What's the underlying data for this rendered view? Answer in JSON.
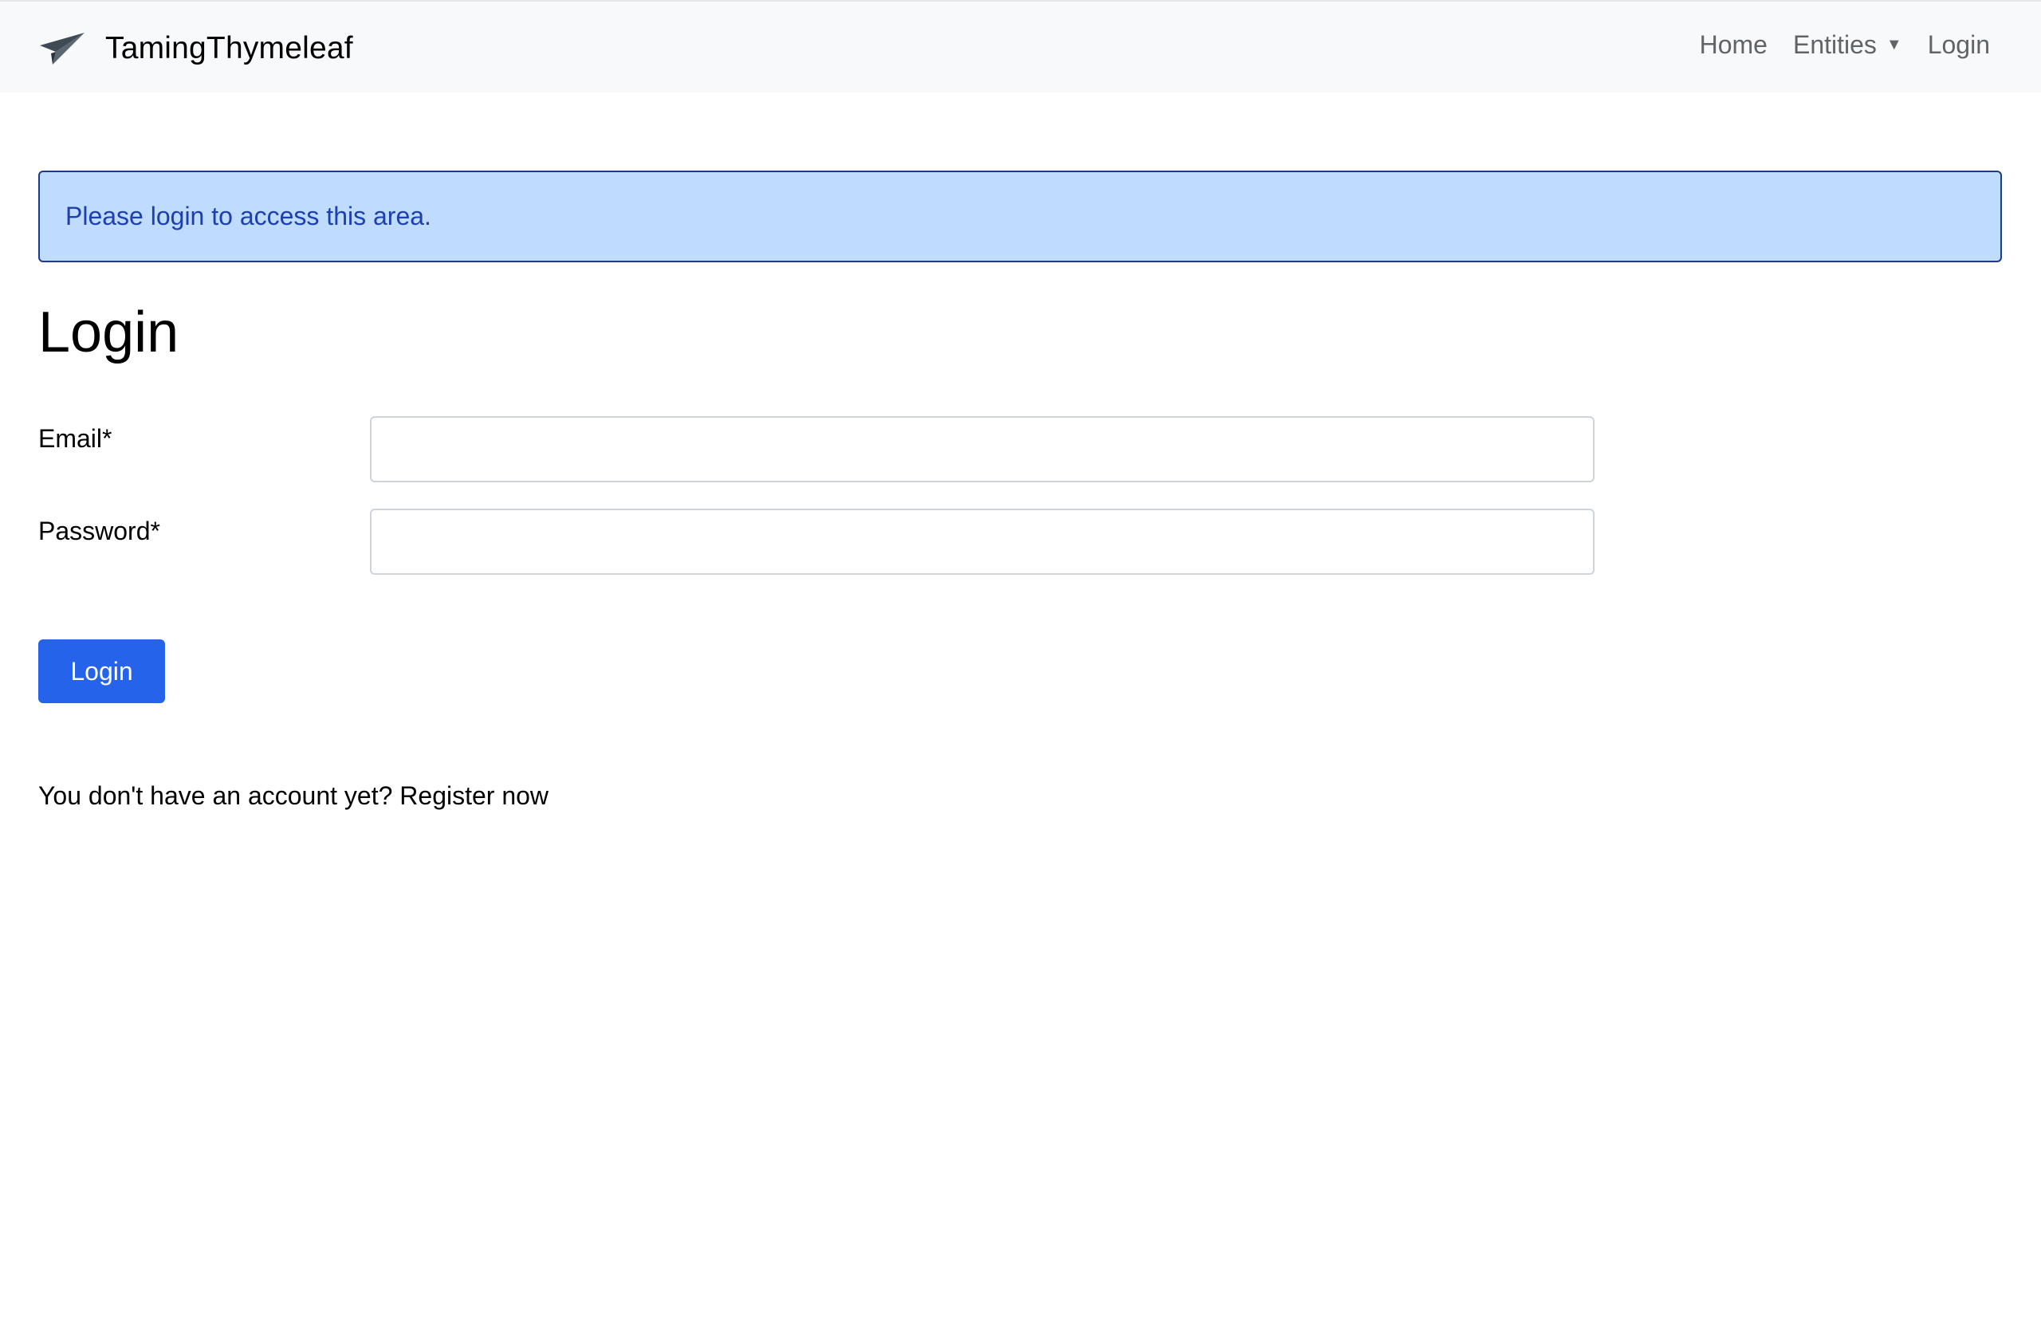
{
  "navbar": {
    "brand_icon": "paper-plane-icon",
    "brand": "TamingThymeleaf",
    "links": {
      "home": "Home",
      "entities": "Entities",
      "entities_caret": "▼",
      "login": "Login"
    }
  },
  "alert": {
    "message": "Please login to access this area.",
    "bg_color": "#bfdbfe",
    "border_color": "#1e3a8a",
    "text_color": "#1e40af"
  },
  "page": {
    "title": "Login"
  },
  "form": {
    "email_label": "Email*",
    "email_value": "",
    "password_label": "Password*",
    "password_value": "",
    "submit_label": "Login",
    "submit_color": "#2563eb"
  },
  "footer": {
    "prompt": "You don't have an account yet?",
    "register_link": "Register now"
  }
}
